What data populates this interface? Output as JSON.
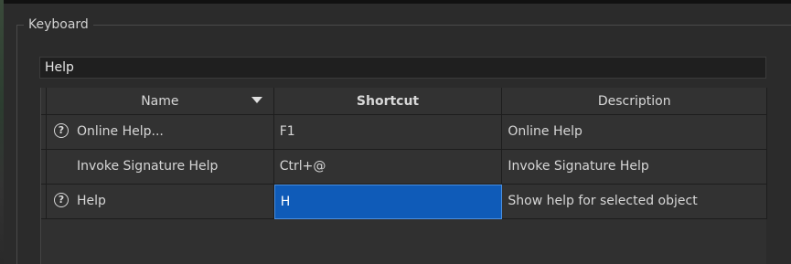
{
  "group": {
    "title": "Keyboard"
  },
  "filter": {
    "value": "Help"
  },
  "table": {
    "columns": [
      {
        "label": "Name"
      },
      {
        "label": "Shortcut"
      },
      {
        "label": "Description"
      }
    ],
    "rows": [
      {
        "icon": "question-circle-icon",
        "name": "Online Help...",
        "shortcut": "F1",
        "description": "Online Help"
      },
      {
        "icon": "",
        "name": "Invoke Signature Help",
        "shortcut": "Ctrl+@",
        "description": "Invoke Signature Help"
      },
      {
        "icon": "question-circle-icon",
        "name": "Help",
        "shortcut": "H",
        "description": "Show help for selected object"
      }
    ],
    "selection_color": "#0f5bb8"
  },
  "icons": {
    "question_glyph": "?"
  }
}
